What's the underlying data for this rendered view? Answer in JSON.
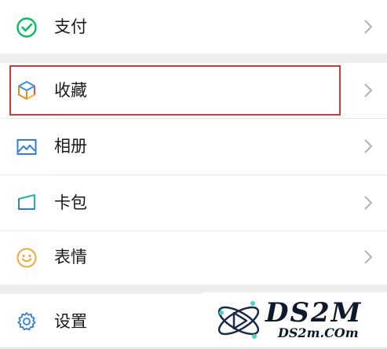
{
  "menu": {
    "pay": {
      "label": "支付",
      "icon": "wechat-pay-icon"
    },
    "favorites": {
      "label": "收藏",
      "icon": "cube-icon"
    },
    "album": {
      "label": "相册",
      "icon": "image-icon"
    },
    "cards": {
      "label": "卡包",
      "icon": "card-icon"
    },
    "stickers": {
      "label": "表情",
      "icon": "smile-icon"
    },
    "settings": {
      "label": "设置",
      "icon": "gear-icon"
    }
  },
  "watermark": {
    "brand": "DS2M",
    "url": "DS2m.COm"
  },
  "colors": {
    "pay_green": "#07c160",
    "highlight_red": "#d9363e",
    "icon_blue": "#2f7fd6",
    "cards_teal": "#1fb6a5",
    "sticker_orange": "#f2a93b"
  }
}
